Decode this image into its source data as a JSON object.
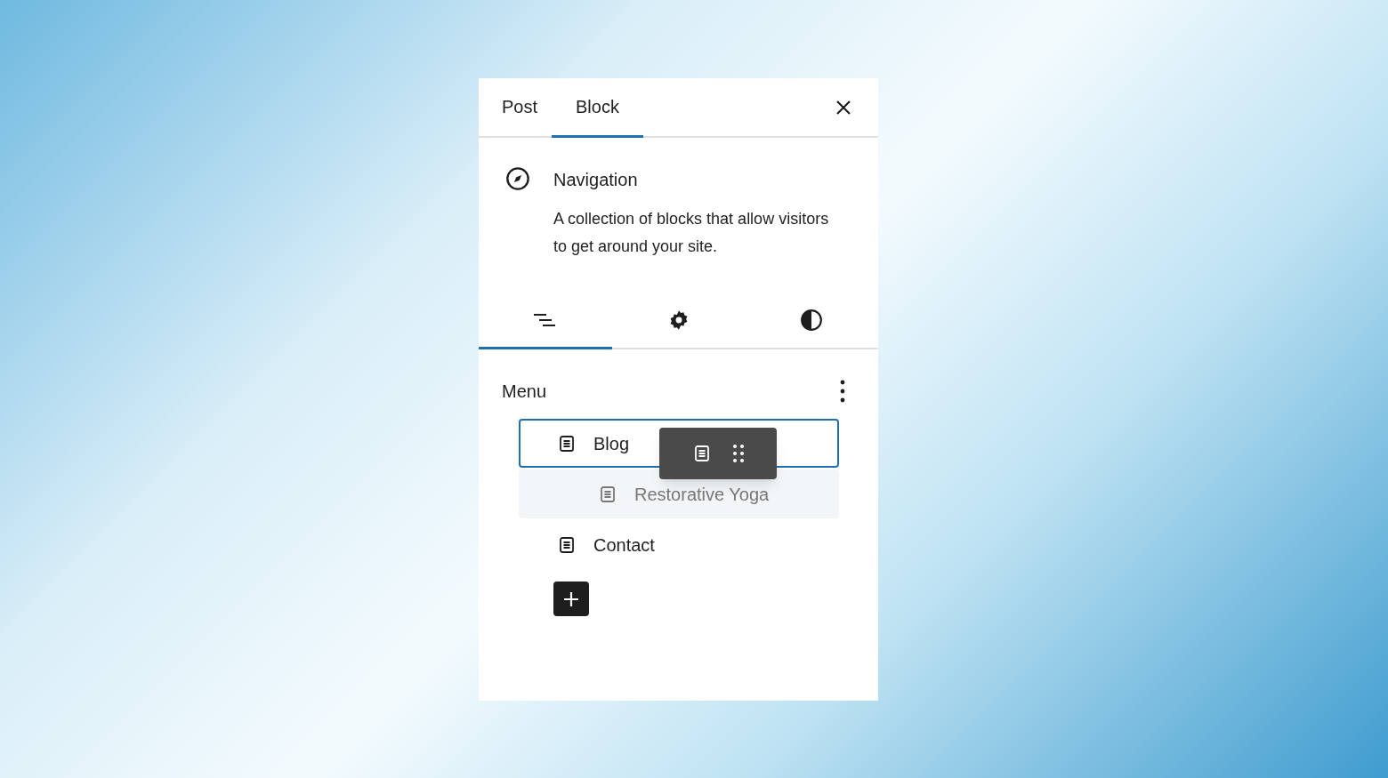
{
  "tabs": [
    {
      "label": "Post",
      "selected": false
    },
    {
      "label": "Block",
      "selected": true
    }
  ],
  "block": {
    "title": "Navigation",
    "description": "A collection of blocks that allow visitors to get around your site."
  },
  "inspector_tabs": [
    {
      "kind": "list",
      "selected": true
    },
    {
      "kind": "settings",
      "selected": false
    },
    {
      "kind": "styles",
      "selected": false
    }
  ],
  "menu": {
    "title": "Menu",
    "items": [
      {
        "label": "Blog",
        "selected": true,
        "drop_target": false,
        "children": [
          {
            "label": "Restorative Yoga",
            "selected": false,
            "drop_target": true
          }
        ]
      },
      {
        "label": "Contact",
        "selected": false,
        "drop_target": false
      }
    ]
  },
  "drag_chip": {
    "visible": true
  }
}
